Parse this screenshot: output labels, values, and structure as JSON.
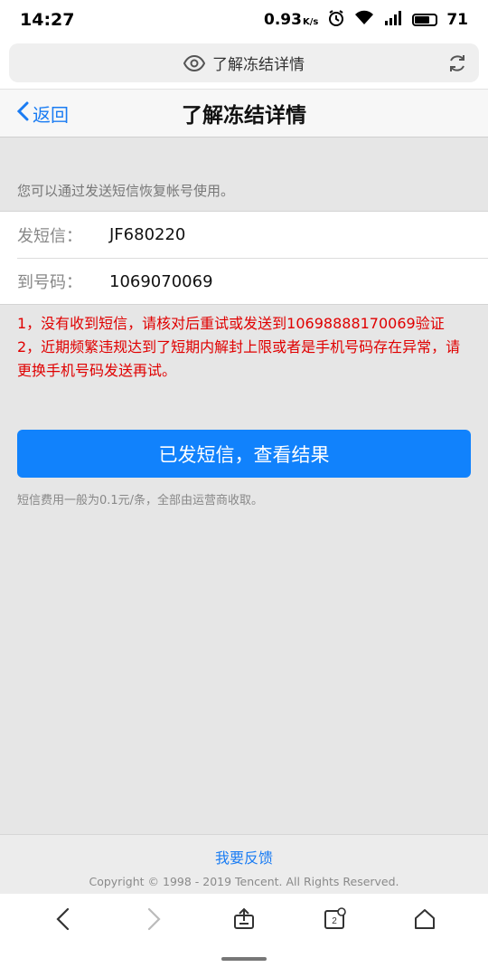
{
  "status_bar": {
    "time": "14:27",
    "net_speed": "0.93",
    "net_unit": "K/s",
    "battery": "71",
    "battery_level": 0.71
  },
  "url_bar": {
    "title": "了解冻结详情"
  },
  "nav": {
    "back_label": "返回",
    "title": "了解冻结详情"
  },
  "main": {
    "hint": "您可以通过发送短信恢复帐号使用。",
    "rows": [
      {
        "label": "发短信：",
        "value": "JF680220"
      },
      {
        "label": "到号码：",
        "value": "1069070069"
      }
    ],
    "warning_1": "1，没有收到短信，请核对后重试或发送到106988881700​69验证",
    "warning_2": "2，近期频繁违规达到了短期内解封上限或者是手机号码存在异常，请更换手机号码发送再试。",
    "primary_button": "已发短信，查看结果",
    "fee_note": "短信费用一般为0.1元/条，全部由运营商收取。"
  },
  "footer": {
    "feedback": "我要反馈",
    "copyright": "Copyright © 1998 - 2019 Tencent. All Rights Reserved."
  },
  "toolbar": {
    "tab_count": "2"
  },
  "colors": {
    "accent": "#1182fc",
    "link": "#1a7cf3",
    "warning": "#e00000",
    "background": "#e6e6e6"
  },
  "icons": [
    "eye-icon",
    "refresh-icon",
    "chevron-left-icon",
    "back-arrow-icon",
    "forward-arrow-icon",
    "share-icon",
    "tabs-icon",
    "home-icon",
    "alarm-icon",
    "wifi-icon",
    "signal-icon",
    "battery-icon"
  ]
}
